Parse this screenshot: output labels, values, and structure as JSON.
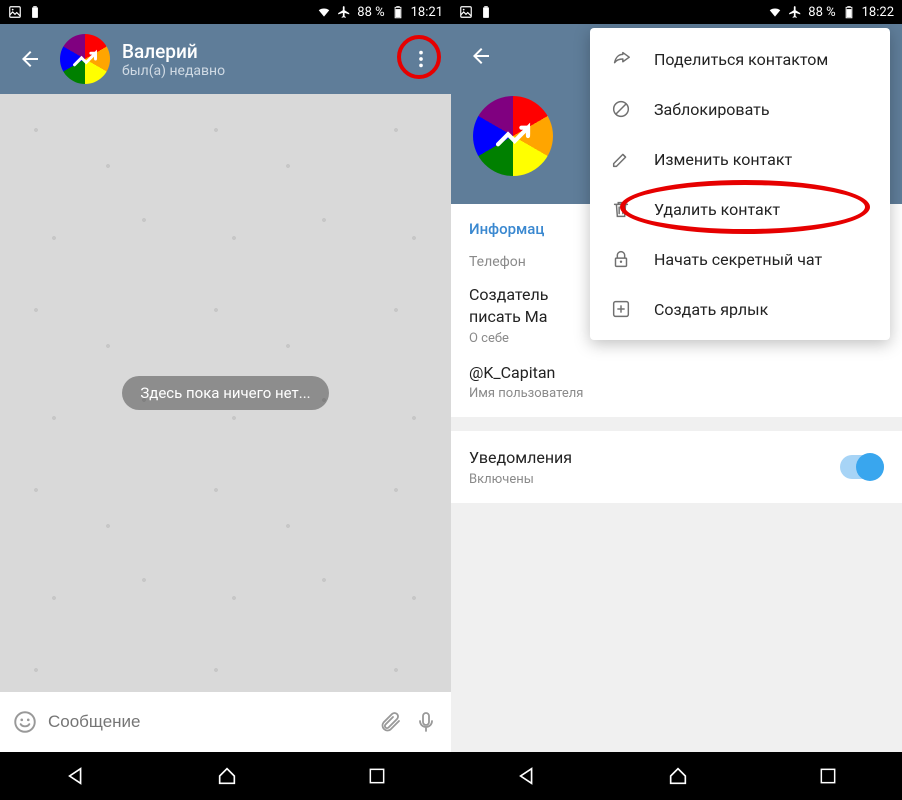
{
  "statusBar": {
    "battery": "88 %",
    "time1": "18:21",
    "time2": "18:22"
  },
  "screen1": {
    "header": {
      "name": "Валерий",
      "status": "был(а) недавно"
    },
    "emptyMessage": "Здесь пока ничего нет...",
    "input": {
      "placeholder": "Сообщение"
    }
  },
  "screen2": {
    "info": {
      "sectionTitle": "Информац",
      "phoneLabel": "Телефон",
      "aboutText": "Создатель\nписать Ма",
      "aboutLabel": "О себе",
      "username": "@K_Capitan",
      "usernameLabel": "Имя пользователя",
      "notifTitle": "Уведомления",
      "notifStatus": "Включены"
    },
    "menu": {
      "items": [
        {
          "label": "Поделиться контактом"
        },
        {
          "label": "Заблокировать"
        },
        {
          "label": "Изменить контакт"
        },
        {
          "label": "Удалить контакт"
        },
        {
          "label": "Начать секретный чат"
        },
        {
          "label": "Создать ярлык"
        }
      ]
    }
  }
}
